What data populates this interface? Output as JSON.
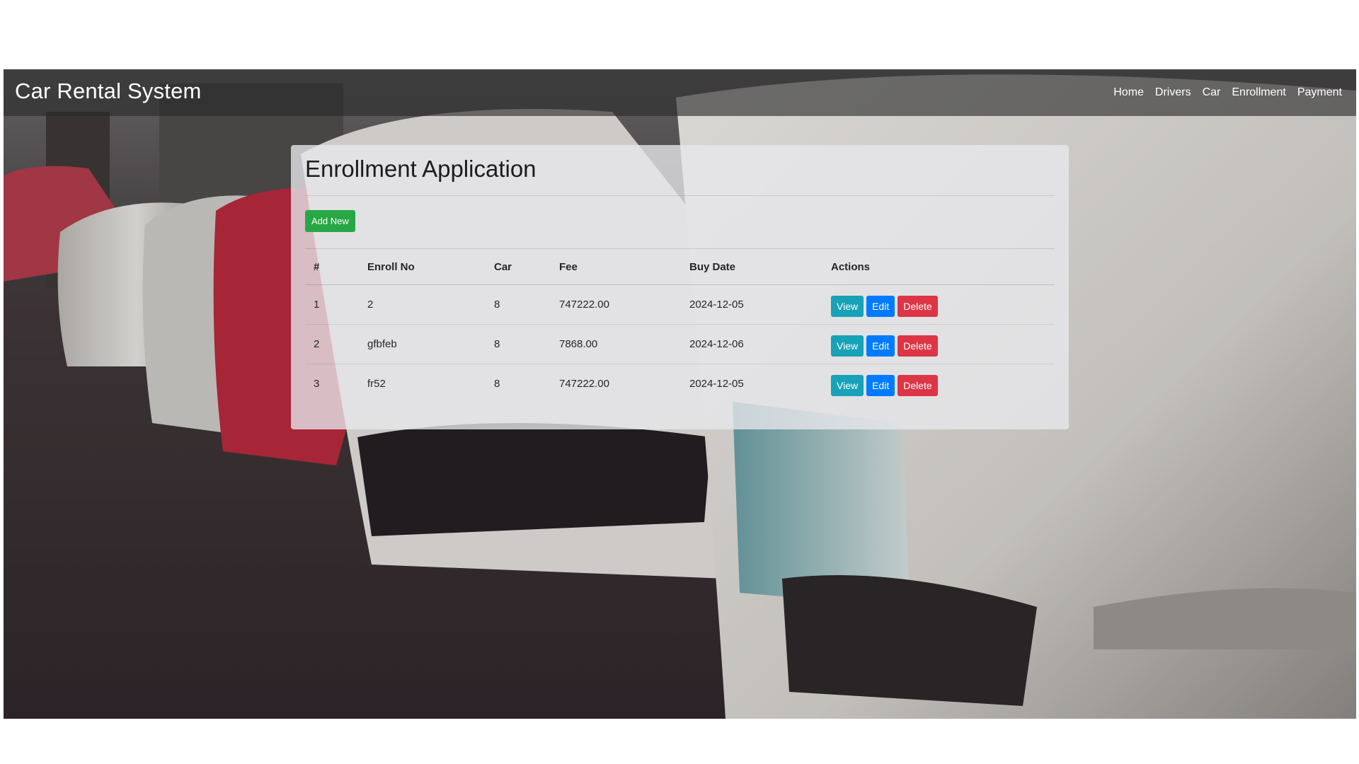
{
  "app": {
    "brand": "Car Rental System"
  },
  "nav": {
    "items": [
      {
        "label": "Home"
      },
      {
        "label": "Drivers"
      },
      {
        "label": "Car"
      },
      {
        "label": "Enrollment"
      },
      {
        "label": "Payment"
      }
    ]
  },
  "page": {
    "title": "Enrollment Application",
    "add_button": "Add New"
  },
  "table": {
    "columns": [
      "#",
      "Enroll No",
      "Car",
      "Fee",
      "Buy Date",
      "Actions"
    ],
    "rows": [
      {
        "num": "1",
        "enroll_no": "2",
        "car": "8",
        "fee": "747222.00",
        "buy_date": "2024-12-05"
      },
      {
        "num": "2",
        "enroll_no": "gfbfeb",
        "car": "8",
        "fee": "7868.00",
        "buy_date": "2024-12-06"
      },
      {
        "num": "3",
        "enroll_no": "fr52",
        "car": "8",
        "fee": "747222.00",
        "buy_date": "2024-12-05"
      }
    ],
    "actions": {
      "view": "View",
      "edit": "Edit",
      "delete": "Delete"
    }
  },
  "colors": {
    "add": "#28a745",
    "view": "#17a2b8",
    "edit": "#007bff",
    "delete": "#dc3545"
  }
}
